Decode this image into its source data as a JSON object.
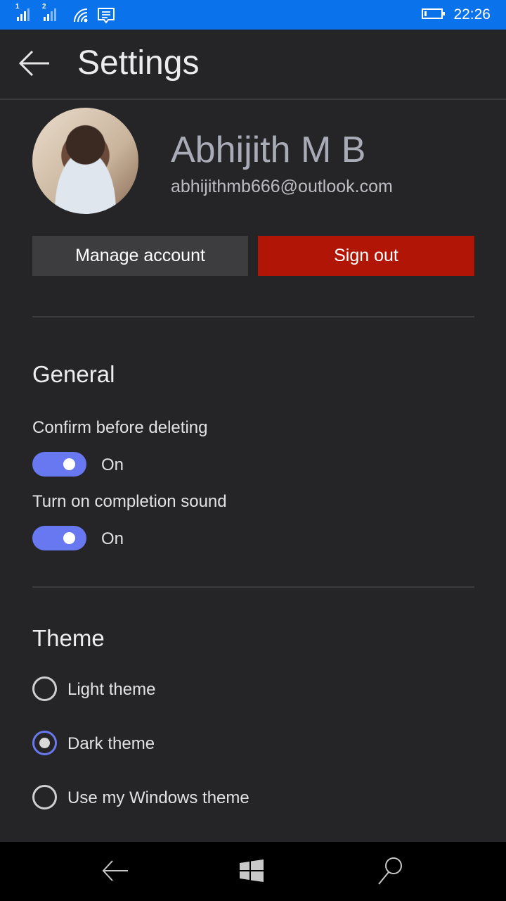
{
  "status_bar": {
    "sim1_label": "1",
    "sim2_label": "2",
    "icons": [
      "signal-sim1-icon",
      "signal-sim2-icon",
      "wifi-icon",
      "message-icon",
      "battery-icon"
    ],
    "time": "22:26"
  },
  "header": {
    "back_icon": "arrow-left-icon",
    "title": "Settings"
  },
  "account": {
    "name": "Abhijith M B",
    "email": "abhijithmb666@outlook.com",
    "manage_label": "Manage account",
    "signout_label": "Sign out"
  },
  "general": {
    "heading": "General",
    "settings": [
      {
        "label": "Confirm before deleting",
        "state": "On",
        "enabled": true
      },
      {
        "label": "Turn on completion sound",
        "state": "On",
        "enabled": true
      }
    ]
  },
  "theme": {
    "heading": "Theme",
    "options": [
      {
        "label": "Light theme",
        "selected": false
      },
      {
        "label": "Dark theme",
        "selected": true
      },
      {
        "label": "Use my Windows theme",
        "selected": false
      }
    ]
  },
  "nav_bar": {
    "icons": [
      "back-icon",
      "windows-start-icon",
      "search-icon"
    ]
  },
  "colors": {
    "status_bar": "#0a72ea",
    "accent": "#6878f0",
    "sign_out": "#b01505",
    "background": "#252528"
  }
}
